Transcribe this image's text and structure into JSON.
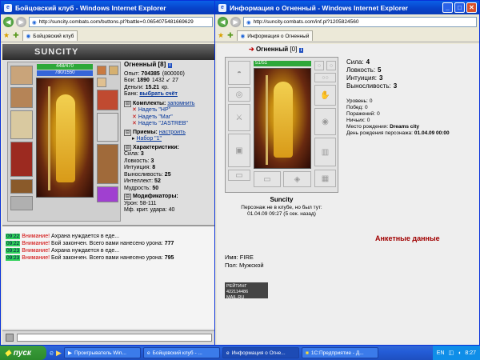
{
  "left_window": {
    "title": "Бойцовский клуб - Windows Internet Explorer",
    "url": "http://suncity.combats.com/buttons.pl?battle=0.0654075481669629",
    "tab": "Бойцовский клуб",
    "banner": "SUNCITY",
    "char_name": "Огненный",
    "char_level": "[8]",
    "hp_bar": "448/470",
    "mana_bar": "780/1550",
    "stats_top": [
      {
        "label": "Опыт:",
        "value": "704385",
        "extra": "(800000)"
      },
      {
        "label": "Бои:",
        "value": "1890",
        "extra": "1432 ↙ 27"
      },
      {
        "label": "Деньги:",
        "value": "15.21",
        "extra": "кр."
      },
      {
        "label": "Банк:",
        "value": "выбрать счёт",
        "extra": ""
      }
    ],
    "sets_header": "Комплекты:",
    "sets_action": "запомнить",
    "sets": [
      {
        "prefix": "Надеть",
        "name": "\"HP\""
      },
      {
        "prefix": "Надеть",
        "name": "\"Маг\""
      },
      {
        "prefix": "Надеть",
        "name": "\"JASTREB\""
      }
    ],
    "tricks_header": "Приемы:",
    "tricks_action": "настроить",
    "tricks_set": "Набор \"1\"",
    "chars_header": "Характеристики:",
    "chars": [
      {
        "label": "Сила:",
        "value": "3"
      },
      {
        "label": "Ловкость:",
        "value": "3"
      },
      {
        "label": "Интуиция:",
        "value": "8"
      },
      {
        "label": "Выносливость:",
        "value": "25"
      },
      {
        "label": "Интеллект:",
        "value": "52"
      },
      {
        "label": "Мудрость:",
        "value": "50"
      }
    ],
    "mods_header": "Модификаторы:",
    "mods": [
      {
        "label": "Урон:",
        "value": "58-111"
      },
      {
        "label": "Мф. крит. удара:",
        "value": "40"
      }
    ],
    "chat": [
      {
        "time": "09:22",
        "warn": "Внимание!",
        "text": "Ахрана нуждается в еде..."
      },
      {
        "time": "09:22",
        "warn": "Внимание!",
        "text": "Бой закончен. Всего вами нанесено урона:",
        "num": "777"
      },
      {
        "time": "09:23",
        "warn": "Внимание!",
        "text": "Ахрана нуждается в еде..."
      },
      {
        "time": "09:23",
        "warn": "Внимание!",
        "text": "Бой закончен. Всего вами нанесено урона:",
        "num": "795"
      }
    ]
  },
  "right_window": {
    "title": "Информация о Огненный - Windows Internet Explorer",
    "url": "http://suncity.combats.com/inf.pl?1205824560",
    "tab": "Информация о Огненный",
    "char_name": "Огненный",
    "char_level": "[0]",
    "hp_bar": "51/51",
    "stats": [
      {
        "label": "Сила:",
        "value": "4"
      },
      {
        "label": "Ловкость:",
        "value": "5"
      },
      {
        "label": "Интуиция:",
        "value": "3"
      },
      {
        "label": "Выносливость:",
        "value": "3"
      }
    ],
    "info": [
      {
        "label": "Уровень:",
        "value": "0"
      },
      {
        "label": "Побед:",
        "value": "0"
      },
      {
        "label": "Поражений:",
        "value": "0"
      },
      {
        "label": "Ничьих:",
        "value": "0"
      },
      {
        "label": "Место рождения:",
        "value": "Dreams city"
      },
      {
        "label": "День рождения персонажа:",
        "value": "01.04.09 00:00"
      }
    ],
    "city": "Suncity",
    "offline1": "Персонаж не в клубе, но был тут:",
    "offline2": "01.04.09 09:27 (5 сек. назад)",
    "anket_header": "Анкетные данные",
    "name_line": "Имя: FIRE",
    "gender_line": "Пол: Мужской",
    "counter": "РЕЙТИНГ 422114486 MAIL.RU"
  },
  "taskbar": {
    "start": "пуск",
    "buttons": [
      "Проигрыватель Win...",
      "Бойцовский клуб - ...",
      "Информация о Огне...",
      "1С:Предприятие - Д..."
    ],
    "lang": "EN",
    "clock": "8:27"
  },
  "colors": {
    "warn": "#d00000",
    "time_bg": "#2fd05a",
    "anket": "#a00000",
    "hp": "#2ea83a",
    "mana": "#3565d8"
  }
}
